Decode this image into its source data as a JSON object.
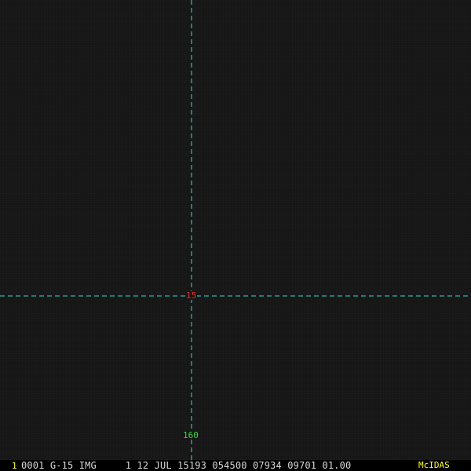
{
  "colors": {
    "grid_line": "#33dddd",
    "lat_label": "#e03030",
    "lon_label": "#33dd33",
    "status_text": "#d8d8d8",
    "frame_number": "#ffff33",
    "brand": "#ffff33",
    "background": "#161616"
  },
  "grid": {
    "latitude_label": "15",
    "longitude_label": "160"
  },
  "status_bar": {
    "frame_number": "1",
    "text": "0001 G-15 IMG     1 12 JUL 15193 054500 07934 09701 01.00",
    "brand": "McIDAS"
  }
}
